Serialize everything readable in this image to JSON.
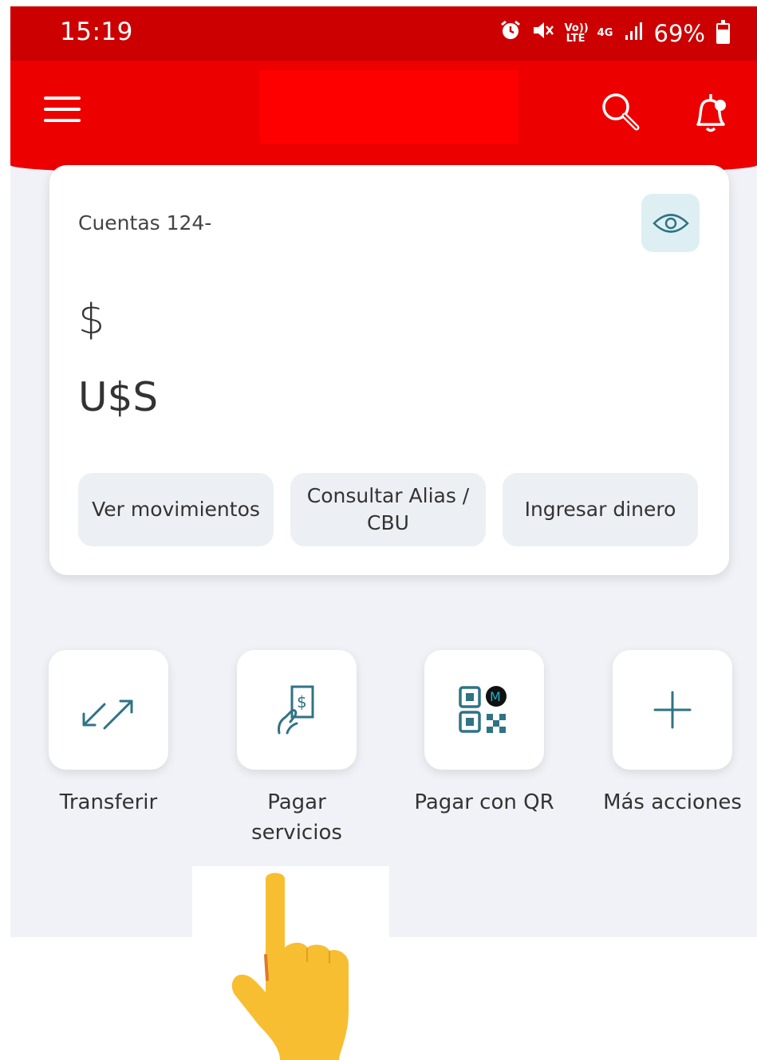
{
  "status_bar": {
    "time": "15:19",
    "volte_label": "Vo)) LTE",
    "network_label": "4G",
    "battery_percent": "69%",
    "battery_level": 0.69,
    "icons": [
      "alarm-icon",
      "mute-icon",
      "volte-icon",
      "4g-icon",
      "signal-icon",
      "battery-icon"
    ]
  },
  "header": {
    "menu_icon": "hamburger-menu-icon",
    "search_icon": "search-icon",
    "notification_icon": "bell-notification-icon",
    "brand_color": "#ec0000"
  },
  "account_card": {
    "label": "Cuentas 124-",
    "ars_symbol": "$",
    "usd_symbol": "U$S",
    "toggle_icon": "eye-icon",
    "buttons": [
      {
        "label": "Ver movimientos"
      },
      {
        "label": "Consultar Alias / CBU"
      },
      {
        "label": "Ingresar dinero"
      }
    ]
  },
  "quick_actions": [
    {
      "label": "Transferir",
      "icon": "transfer-arrows-icon"
    },
    {
      "label": "Pagar servicios",
      "icon": "pay-bill-hand-icon"
    },
    {
      "label": "Pagar con QR",
      "icon": "qr-code-icon"
    },
    {
      "label": "Más acciones",
      "icon": "plus-icon"
    }
  ],
  "overlay": {
    "icon": "pointing-hand-emoji"
  },
  "colors": {
    "status_bar": "#cc0000",
    "header": "#ec0000",
    "accent_teal": "#2f7385",
    "background": "#f0f2f7"
  }
}
